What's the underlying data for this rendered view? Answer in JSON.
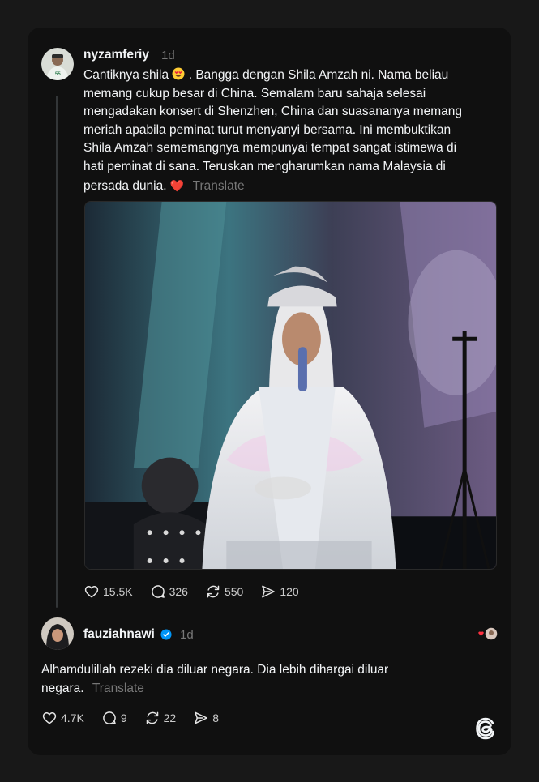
{
  "post": {
    "username": "nyzamferiy",
    "time": "1d",
    "text_before_emoji": "Cantiknya shila",
    "emoji_name": "heart-eyes-emoji",
    "text_lines": [
      ". Bangga dengan Shila Amzah ni. Nama beliau",
      "memang cukup besar di China. Semalam baru sahaja selesai",
      "mengadakan konsert di Shenzhen, China dan suasananya memang",
      "meriah apabila peminat turut menyanyi bersama. Ini membuktikan",
      "Shila Amzah sememangnya mempunyai tempat sangat istimewa di",
      "hati peminat di sana. Teruskan mengharumkan nama Malaysia di",
      "persada dunia."
    ],
    "heart": "❤️",
    "translate_label": "Translate",
    "likes": "15.5K",
    "comments": "326",
    "reposts": "550",
    "shares": "120"
  },
  "reply": {
    "username": "fauziahnawi",
    "time": "1d",
    "verified": true,
    "text_lines": [
      "Alhamdulillah rezeki dia diluar negara. Dia lebih dihargai diluar",
      "negara."
    ],
    "translate_label": "Translate",
    "likes": "4.7K",
    "comments": "9",
    "reposts": "22",
    "shares": "8"
  },
  "colors": {
    "background": "#181818",
    "card": "#101010",
    "text": "#f3f5f7",
    "muted": "#777777",
    "verified_blue": "#0095f6",
    "heart_red": "#ff3040"
  },
  "icons": {
    "like": "heart-outline-icon",
    "comment": "speech-bubble-icon",
    "repost": "repost-icon",
    "share": "send-icon",
    "brand": "threads-logo-icon"
  }
}
